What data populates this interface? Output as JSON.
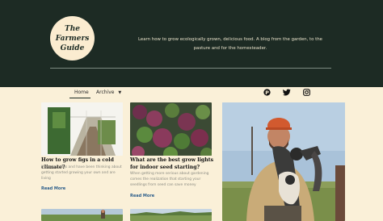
{
  "site": {
    "logo_line1": "The Farmers",
    "logo_line2": "Guide",
    "tagline": "Learn how to grow ecologically grown, delicious food. A blog from the garden, to the pasture and for the homesteader."
  },
  "nav": {
    "items": [
      {
        "label": "Home"
      },
      {
        "label": "Archive"
      }
    ],
    "social_icons": [
      "pinterest-icon",
      "twitter-icon",
      "instagram-icon"
    ]
  },
  "posts": [
    {
      "title": "How to grow figs in a cold climate?",
      "excerpt": "If you love figs and have been thinking about getting started growing your own and are living",
      "read_more": "Read More"
    },
    {
      "title": "What are the best grow lights for indoor seed starting?",
      "excerpt": "When getting more serious about gardening comes the realization that starting your seedlings from seed can save money",
      "read_more": "Read More"
    }
  ],
  "colors": {
    "header_bg": "#1d2b24",
    "page_bg": "#faf0d8",
    "link": "#2b5d8a"
  }
}
